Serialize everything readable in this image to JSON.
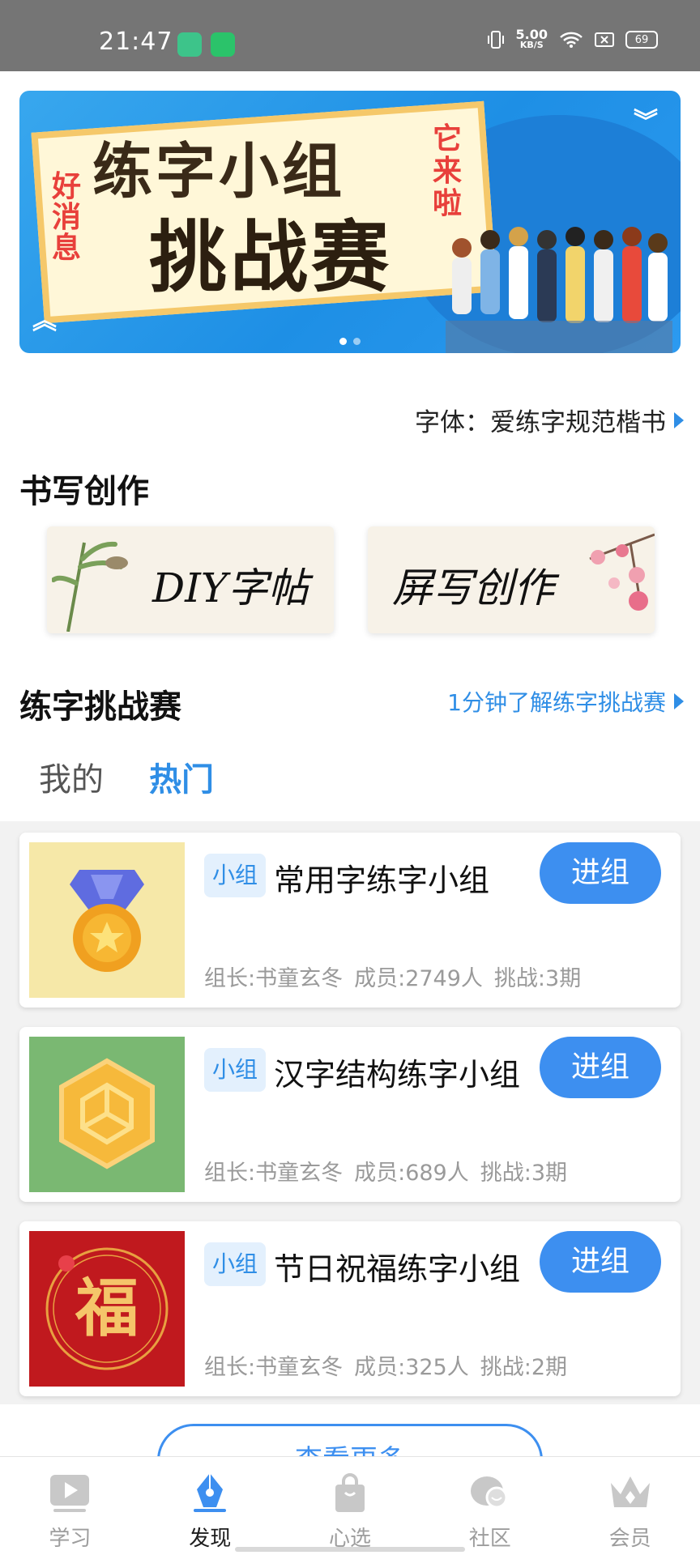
{
  "status_bar": {
    "time": "21:47",
    "speed_value": "5.00",
    "speed_unit": "KB/S",
    "battery": "69"
  },
  "banner": {
    "title_line1": "练字小组",
    "title_line2": "挑战赛",
    "tag_left": "好消息",
    "tag_right": "它来啦",
    "page_count": 2,
    "active_page": 1
  },
  "font_setting": {
    "label": "字体：爱练字规范楷书"
  },
  "writing_section": {
    "title": "书写创作",
    "cards": [
      {
        "label": "DIY字帖"
      },
      {
        "label": "屏写创作"
      }
    ]
  },
  "challenge_section": {
    "title": "练字挑战赛",
    "link": "1分钟了解练字挑战赛",
    "tabs": [
      {
        "label": "我的",
        "active": false
      },
      {
        "label": "热门",
        "active": true
      }
    ],
    "groups": [
      {
        "badge": "小组",
        "name": "常用字练字小组",
        "join": "进组",
        "leader": "组长:书童玄冬",
        "members": "成员:2749人",
        "challenges": "挑战:3期",
        "thumb": "medal-icon"
      },
      {
        "badge": "小组",
        "name": "汉字结构练字小组",
        "join": "进组",
        "leader": "组长:书童玄冬",
        "members": "成员:689人",
        "challenges": "挑战:3期",
        "thumb": "cube-icon"
      },
      {
        "badge": "小组",
        "name": "节日祝福练字小组",
        "join": "进组",
        "leader": "组长:书童玄冬",
        "members": "成员:325人",
        "challenges": "挑战:2期",
        "thumb": "fu-icon",
        "thumb_text": "福"
      }
    ],
    "more": "查看更多"
  },
  "tabbar": [
    {
      "label": "学习",
      "icon": "play-icon",
      "active": false
    },
    {
      "label": "发现",
      "icon": "pen-icon",
      "active": true
    },
    {
      "label": "心选",
      "icon": "bag-icon",
      "active": false
    },
    {
      "label": "社区",
      "icon": "chat-icon",
      "active": false
    },
    {
      "label": "会员",
      "icon": "crown-icon",
      "active": false
    }
  ],
  "colors": {
    "accent": "#3d8ff0",
    "banner": "#1e8fe5",
    "list_bg": "#f2f2f2"
  }
}
